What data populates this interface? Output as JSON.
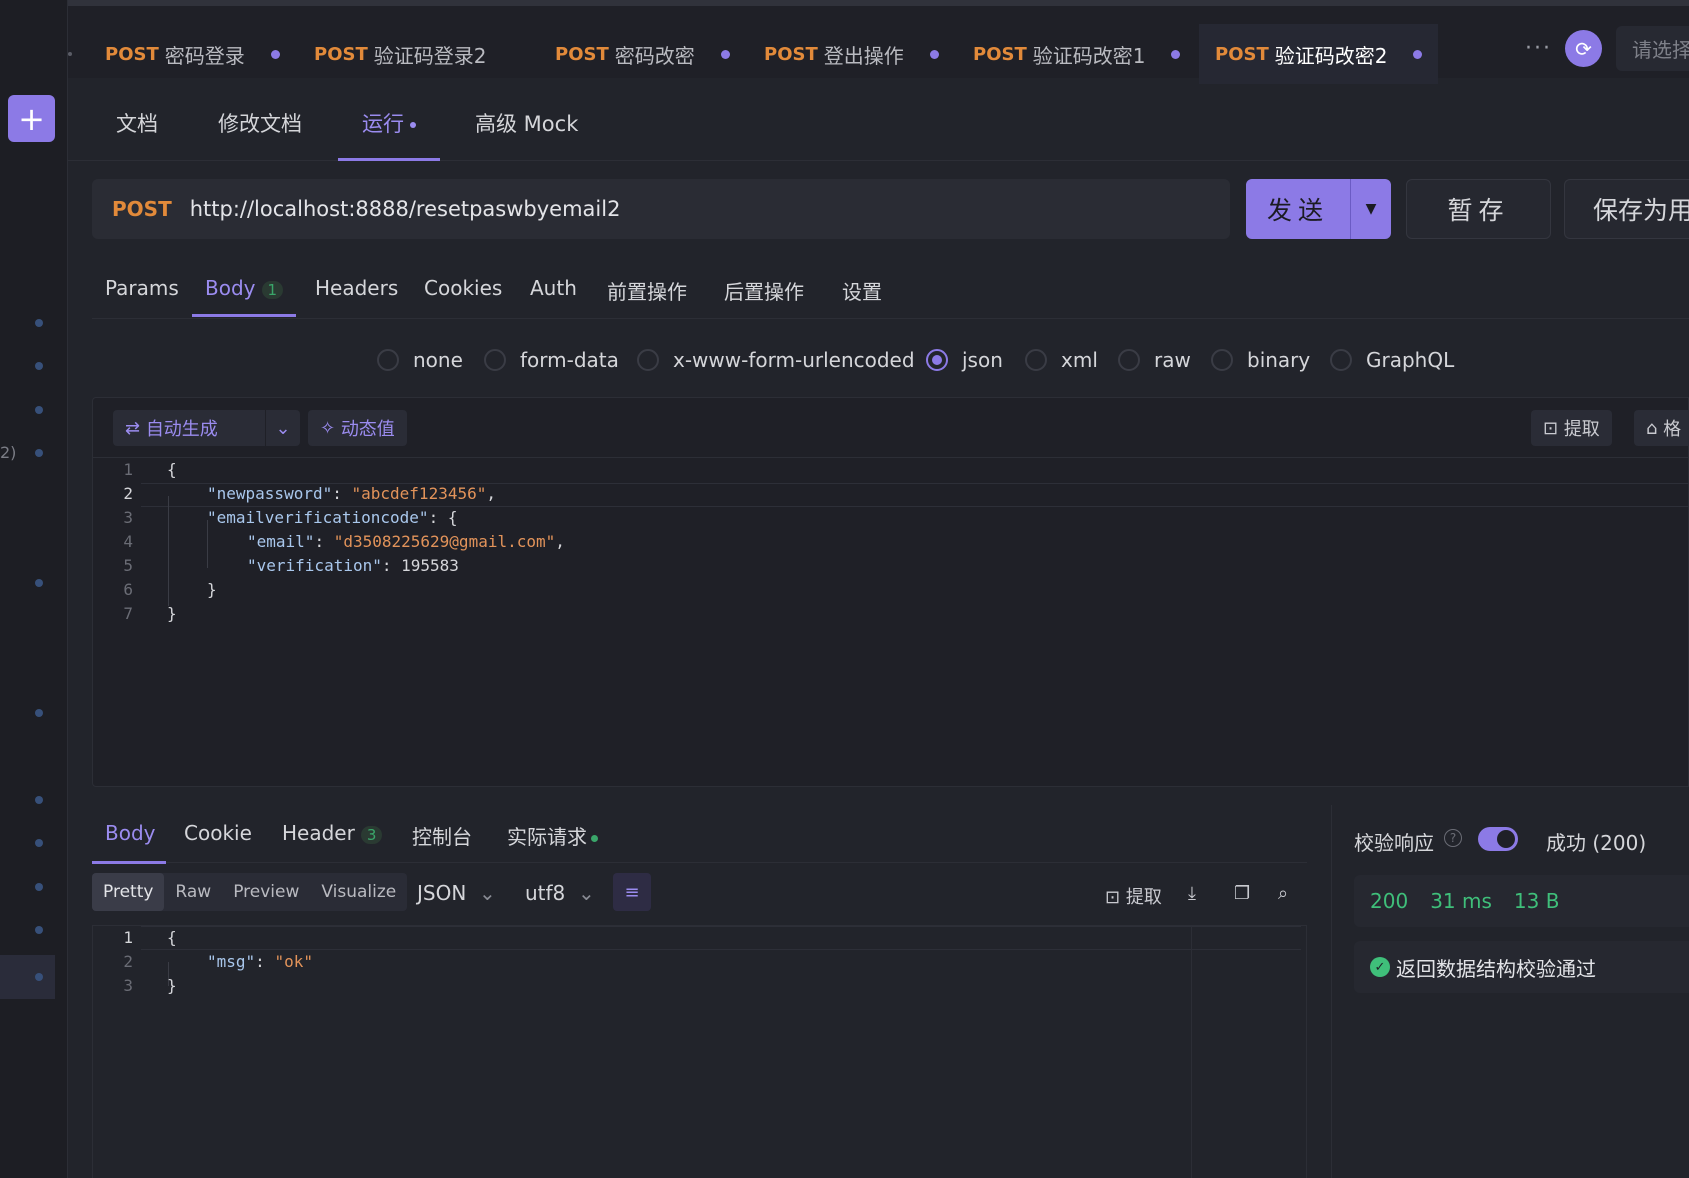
{
  "top_tabs": [
    {
      "method": "POST",
      "name": "密码登录",
      "dirty": true
    },
    {
      "method": "POST",
      "name": "验证码登录2",
      "dirty": false
    },
    {
      "method": "POST",
      "name": "密码改密",
      "dirty": true
    },
    {
      "method": "POST",
      "name": "登出操作",
      "dirty": true
    },
    {
      "method": "POST",
      "name": "验证码改密1",
      "dirty": true
    },
    {
      "method": "POST",
      "name": "验证码改密2",
      "dirty": true,
      "active": true
    }
  ],
  "more_label": "···",
  "env_placeholder": "请选择环境",
  "sub_tabs": [
    "文档",
    "修改文档",
    "运行",
    "高级 Mock"
  ],
  "request": {
    "method": "POST",
    "url": "http://localhost:8888/resetpaswbyemail2",
    "send_label": "发送",
    "stash_label": "暂存",
    "save_as_label": "保存为用"
  },
  "req_tabs": [
    "Params",
    "Body",
    "Headers",
    "Cookies",
    "Auth",
    "前置操作",
    "后置操作",
    "设置"
  ],
  "body_badge": "1",
  "body_types": [
    "none",
    "form-data",
    "x-www-form-urlencoded",
    "json",
    "xml",
    "raw",
    "binary",
    "GraphQL"
  ],
  "body_type_selected": "json",
  "editor_toolbar": {
    "auto_gen": "自动生成",
    "dynamic": "动态值",
    "extract": "提取",
    "format": "格"
  },
  "request_body_lines": [
    {
      "n": "1",
      "t": "{"
    },
    {
      "n": "2",
      "k": "\"newpassword\"",
      "s": "\"abcdef123456\"",
      "tail": ","
    },
    {
      "n": "3",
      "k": "\"emailverificationcode\"",
      "tail": ": {"
    },
    {
      "n": "4",
      "k": "\"email\"",
      "s": "\"d3508225629@gmail.com\"",
      "tail": ","
    },
    {
      "n": "5",
      "k": "\"verification\"",
      "num": "195583"
    },
    {
      "n": "6",
      "t": "}"
    },
    {
      "n": "7",
      "t": "}"
    }
  ],
  "response": {
    "tabs": [
      "Body",
      "Cookie",
      "Header",
      "控制台",
      "实际请求"
    ],
    "header_badge": "3",
    "views": [
      "Pretty",
      "Raw",
      "Preview",
      "Visualize"
    ],
    "format": "JSON",
    "encoding": "utf8",
    "extract_label": "提取",
    "body_lines": [
      {
        "n": "1",
        "t": "{"
      },
      {
        "n": "2",
        "k": "\"msg\"",
        "s": "\"ok\""
      },
      {
        "n": "3",
        "t": "}"
      }
    ]
  },
  "validation": {
    "title": "校验响应",
    "help": "?",
    "result": "成功 (200)",
    "status": "200",
    "time": "31 ms",
    "size": "13 B",
    "pass_text": "返回数据结构校验通过"
  },
  "rail": {
    "add": "+",
    "edge_text": "2)"
  }
}
